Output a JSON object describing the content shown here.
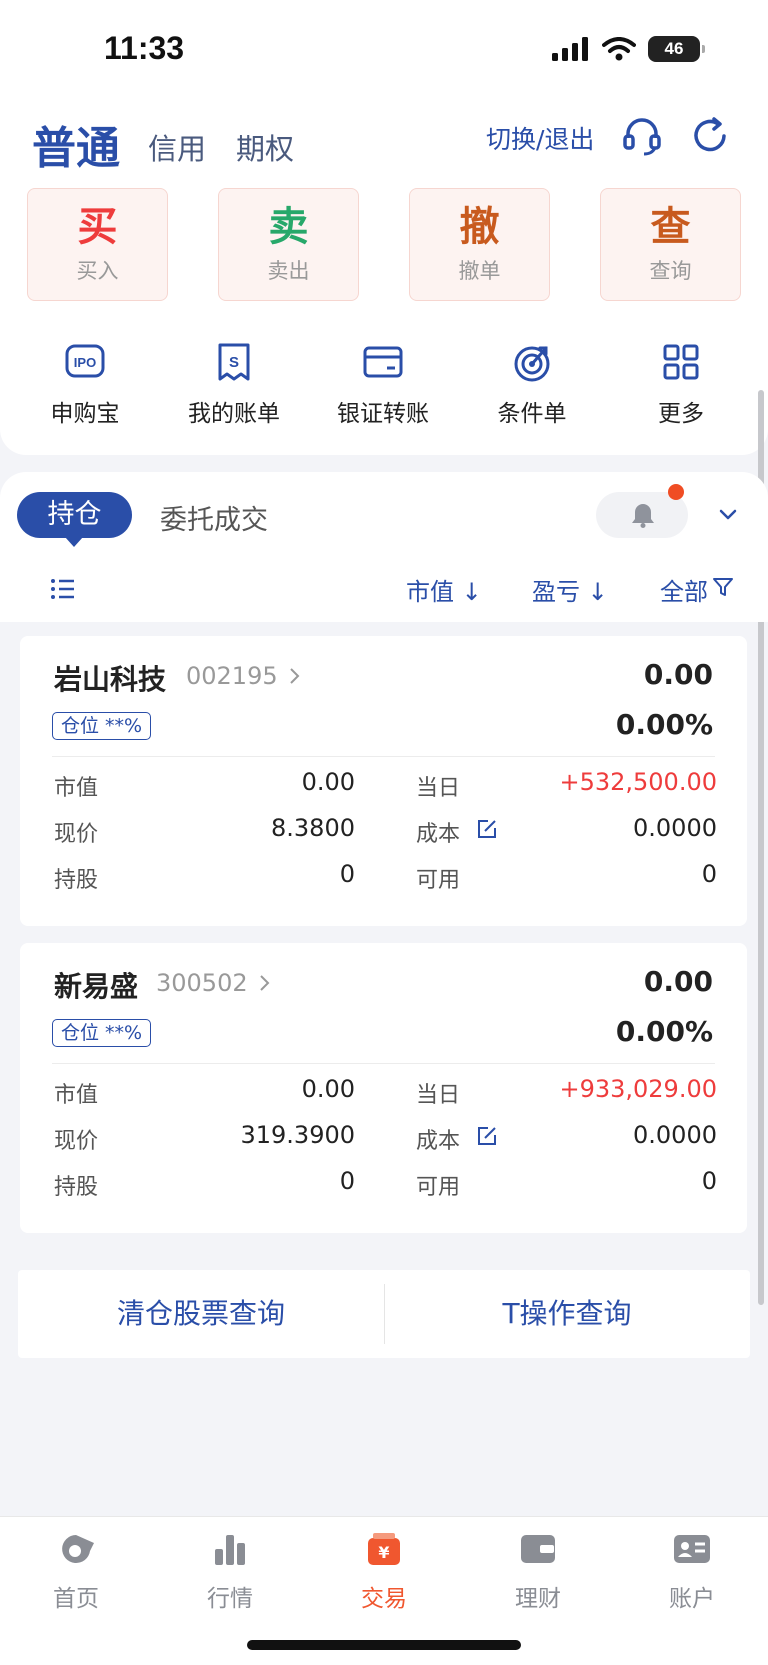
{
  "status": {
    "time": "11:33",
    "battery": "46"
  },
  "header": {
    "tabs": [
      {
        "label": "普通"
      },
      {
        "label": "信用"
      },
      {
        "label": "期权"
      }
    ],
    "switch_label": "切换/退出"
  },
  "actions": [
    {
      "big": "买",
      "small": "买入",
      "color": "#ee3c3c"
    },
    {
      "big": "卖",
      "small": "卖出",
      "color": "#27a86a"
    },
    {
      "big": "撤",
      "small": "撤单",
      "color": "#c85a1e"
    },
    {
      "big": "查",
      "small": "查询",
      "color": "#c85a1e"
    }
  ],
  "quick": [
    {
      "label": "申购宝",
      "icon": "ipo-icon"
    },
    {
      "label": "我的账单",
      "icon": "bill-icon"
    },
    {
      "label": "银证转账",
      "icon": "card-icon"
    },
    {
      "label": "条件单",
      "icon": "target-icon"
    },
    {
      "label": "更多",
      "icon": "grid-icon"
    }
  ],
  "positions": {
    "tab_active": "持仓",
    "tab_other": "委托成交",
    "sort_value": "市值 ↓",
    "sort_pnl": "盈亏 ↓",
    "filter": "全部"
  },
  "stocks": [
    {
      "name": "岩山科技",
      "code": "002195",
      "value": "0.00",
      "pct": "0.00%",
      "badge": "仓位 **%",
      "labels": {
        "mkt": "市值",
        "day": "当日",
        "price": "现价",
        "cost": "成本",
        "shares": "持股",
        "avail": "可用"
      },
      "mkt": "0.00",
      "day": "+532,500.00",
      "price": "8.3800",
      "cost": "0.0000",
      "shares": "0",
      "avail": "0"
    },
    {
      "name": "新易盛",
      "code": "300502",
      "value": "0.00",
      "pct": "0.00%",
      "badge": "仓位 **%",
      "labels": {
        "mkt": "市值",
        "day": "当日",
        "price": "现价",
        "cost": "成本",
        "shares": "持股",
        "avail": "可用"
      },
      "mkt": "0.00",
      "day": "+933,029.00",
      "price": "319.3900",
      "cost": "0.0000",
      "shares": "0",
      "avail": "0"
    }
  ],
  "query": {
    "clear": "清仓股票查询",
    "t_op": "T操作查询"
  },
  "nav": [
    {
      "label": "首页",
      "icon": "home-icon"
    },
    {
      "label": "行情",
      "icon": "chart-icon"
    },
    {
      "label": "交易",
      "icon": "trade-icon",
      "active": true
    },
    {
      "label": "理财",
      "icon": "wallet-icon"
    },
    {
      "label": "账户",
      "icon": "account-icon"
    }
  ],
  "colors": {
    "accent": "#2a4ea8",
    "up": "#ee3c3c",
    "nav_active": "#f0572f"
  }
}
